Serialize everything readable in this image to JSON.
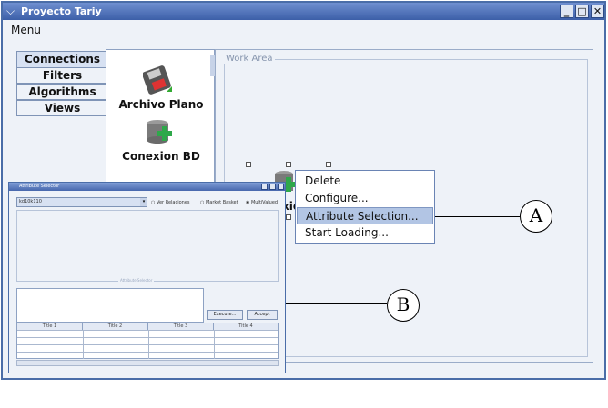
{
  "window": {
    "title": "Proyecto Tariy",
    "menu": "Menu"
  },
  "tabs": [
    {
      "label": "Connections"
    },
    {
      "label": "Filters"
    },
    {
      "label": "Algorithms"
    },
    {
      "label": "Views"
    }
  ],
  "palette": {
    "items": [
      {
        "label": "Archivo Plano",
        "icon": "floppy-disk-icon"
      },
      {
        "label": "Conexion BD",
        "icon": "database-add-icon"
      }
    ]
  },
  "workarea": {
    "label": "Work Area",
    "node_label_fragment": "xio"
  },
  "context_menu": {
    "items": [
      {
        "label": "Delete"
      },
      {
        "label": "Configure..."
      },
      {
        "label": "Attribute Selection...",
        "selected": true
      },
      {
        "label": "Start Loading..."
      }
    ]
  },
  "dialog": {
    "title": "Attribute Selector",
    "combo_value": "kd10k110",
    "options": [
      {
        "label": "Ver Relaciones",
        "checked": false
      },
      {
        "label": "Market Basket",
        "checked": false
      },
      {
        "label": "MultiValued",
        "checked": true
      }
    ],
    "area_label": "Attribute Selector",
    "execute_label": "Execute...",
    "accept_label": "Accept",
    "columns": [
      "Title 1",
      "Title 2",
      "Title 3",
      "Title 4"
    ]
  },
  "callouts": {
    "a": "A",
    "b": "B"
  },
  "colors": {
    "titlebar": "#4a6da8",
    "selection": "#b2c5e4",
    "background": "#eef2f8"
  }
}
